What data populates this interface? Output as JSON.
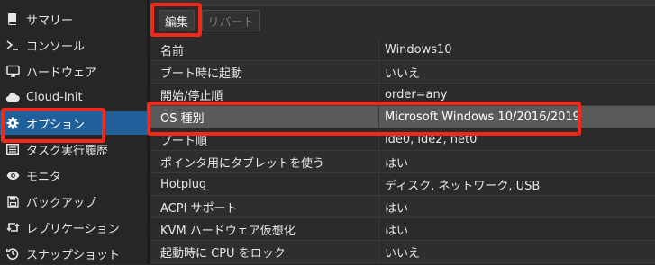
{
  "sidebar": {
    "items": [
      {
        "label": "サマリー",
        "icon": "book-icon"
      },
      {
        "label": "コンソール",
        "icon": "terminal-icon"
      },
      {
        "label": "ハードウェア",
        "icon": "monitor-icon"
      },
      {
        "label": "Cloud-Init",
        "icon": "cloud-icon"
      },
      {
        "label": "オプション",
        "icon": "gear-icon",
        "active": true
      },
      {
        "label": "タスク実行履歴",
        "icon": "list-icon"
      },
      {
        "label": "モニタ",
        "icon": "eye-icon"
      },
      {
        "label": "バックアップ",
        "icon": "floppy-icon"
      },
      {
        "label": "レプリケーション",
        "icon": "retweet-icon"
      },
      {
        "label": "スナップショット",
        "icon": "history-icon"
      }
    ]
  },
  "toolbar": {
    "edit_label": "編集",
    "revert_label": "リバート"
  },
  "options": [
    {
      "key": "名前",
      "value": "Windows10"
    },
    {
      "key": "ブート時に起動",
      "value": "いいえ"
    },
    {
      "key": "開始/停止順",
      "value": "order=any"
    },
    {
      "key": "OS 種別",
      "value": "Microsoft Windows 10/2016/2019",
      "selected": true
    },
    {
      "key": "ブート順",
      "value": "ide0, ide2, net0"
    },
    {
      "key": "ポインタ用にタブレットを使う",
      "value": "はい"
    },
    {
      "key": "Hotplug",
      "value": "ディスク, ネットワーク, USB"
    },
    {
      "key": "ACPI サポート",
      "value": "はい"
    },
    {
      "key": "KVM ハードウェア仮想化",
      "value": "はい"
    },
    {
      "key": "起動時に CPU をロック",
      "value": "いいえ"
    }
  ],
  "colors": {
    "accent_active": "#1f5f9a",
    "highlight_box": "#f2281a",
    "selected_row": "#5a5a5a"
  }
}
